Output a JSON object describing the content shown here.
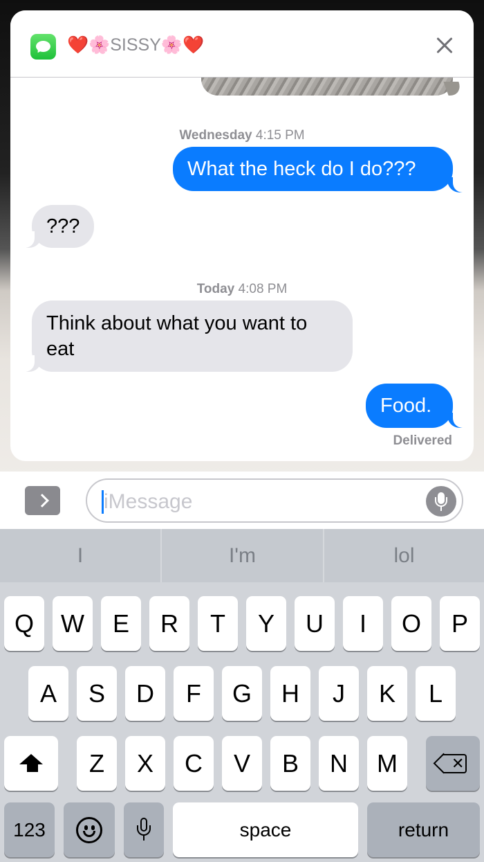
{
  "notification": {
    "app_icon": "messages-icon",
    "contact_name": "❤️🌸SISSY🌸❤️",
    "close_icon": "close-icon"
  },
  "thread": {
    "timestamps": [
      {
        "day": "Wednesday",
        "time": "4:15 PM"
      },
      {
        "day": "Today",
        "time": "4:08 PM"
      }
    ],
    "messages": [
      {
        "direction": "sent",
        "text": "What the heck do I do???"
      },
      {
        "direction": "received",
        "text": "???"
      },
      {
        "direction": "received",
        "text": "Think about what you want to eat"
      },
      {
        "direction": "sent",
        "text": "Food."
      }
    ],
    "status": "Delivered"
  },
  "composer": {
    "placeholder": "iMessage",
    "expand_icon": "chevron-right-icon",
    "mic_icon": "microphone-icon"
  },
  "keyboard": {
    "suggestions": [
      "I",
      "I'm",
      "lol"
    ],
    "row1": [
      "Q",
      "W",
      "E",
      "R",
      "T",
      "Y",
      "U",
      "I",
      "O",
      "P"
    ],
    "row2": [
      "A",
      "S",
      "D",
      "F",
      "G",
      "H",
      "J",
      "K",
      "L"
    ],
    "row3": [
      "Z",
      "X",
      "C",
      "V",
      "B",
      "N",
      "M"
    ],
    "numbers_label": "123",
    "space_label": "space",
    "return_label": "return"
  },
  "colors": {
    "sent_bubble": "#0a7cff",
    "received_bubble": "#e5e5ea",
    "keyboard_bg": "#d1d4d9"
  }
}
